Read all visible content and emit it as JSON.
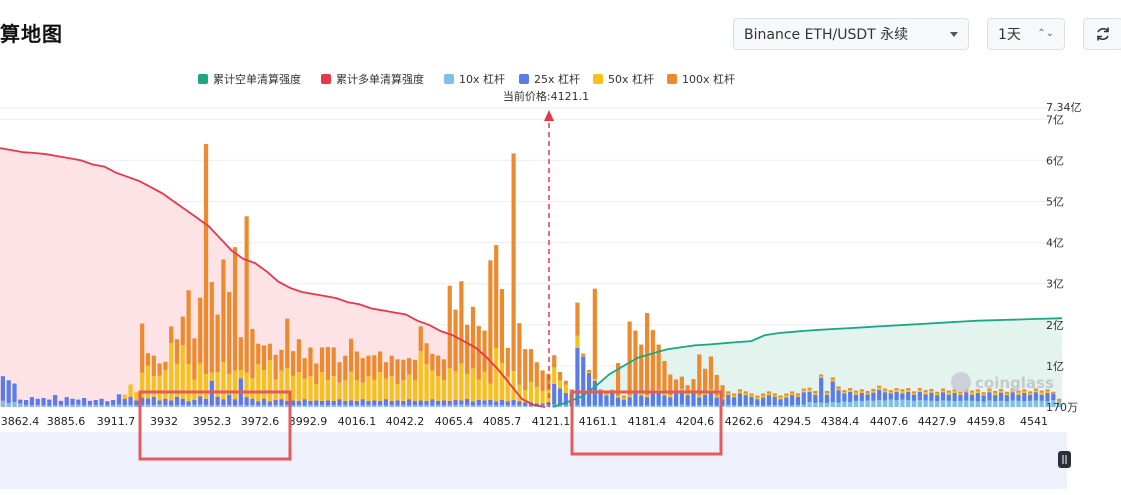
{
  "header": {
    "title": "算地图",
    "market": "Binance ETH/USDT 永续",
    "period": "1天",
    "period_arrows": "⌃⌄"
  },
  "colors": {
    "short_cum": "#1aa784",
    "long_cum": "#e8374b",
    "lev10": "#7fbfe8",
    "lev25": "#5b7be8",
    "lev50": "#f6c21a",
    "lev100": "#ee8a2e",
    "long_fill": "#fde3e5",
    "short_fill": "#e3f4ef",
    "price_line": "#e8374b",
    "highlight_box": "#e25c5c"
  },
  "chart_data": {
    "type": "bar",
    "legend": [
      {
        "key": "short_cum",
        "label": "累计空单清算强度",
        "kind": "line"
      },
      {
        "key": "long_cum",
        "label": "累计多单清算强度",
        "kind": "line"
      },
      {
        "key": "lev10",
        "label": "10x 杠杆",
        "kind": "bar"
      },
      {
        "key": "lev25",
        "label": "25x 杠杆",
        "kind": "bar"
      },
      {
        "key": "lev50",
        "label": "50x 杠杆",
        "kind": "bar"
      },
      {
        "key": "lev100",
        "label": "100x 杠杆",
        "kind": "bar"
      }
    ],
    "current_price_label": "当前价格:4121.1",
    "current_price": 4121.1,
    "x_ticks": [
      "3862.4",
      "3885.6",
      "3911.7",
      "3932",
      "3952.3",
      "3972.6",
      "3992.9",
      "4016.1",
      "4042.2",
      "4065.4",
      "4085.7",
      "4121.1",
      "4161.1",
      "4181.4",
      "4204.6",
      "4262.6",
      "4294.5",
      "4384.4",
      "4407.6",
      "4427.9",
      "4459.8",
      "4541"
    ],
    "y_ticks": [
      "170万",
      "1亿",
      "2亿",
      "3亿",
      "4亿",
      "5亿",
      "6亿",
      "7亿"
    ],
    "y_top_label": "7.34亿",
    "y_max_yi": 7.34,
    "highlighted_ranges": [
      [
        "3932",
        "3972.6"
      ],
      [
        "4161.1",
        "4204.6"
      ]
    ],
    "watermark": "coinglass",
    "series": {
      "lev10": [
        0.15,
        0.1,
        0.12,
        0.08,
        0.05,
        0.04,
        0.05,
        0.04,
        0.03,
        0.04,
        0.05,
        0.04,
        0.05,
        0.06,
        0.04,
        0.05,
        0.05,
        0.05,
        0.04,
        0.05,
        0.06,
        0.05,
        0.05,
        0.04,
        0.05,
        0.06,
        0.05,
        0.06,
        0.05,
        0.04,
        0.05,
        0.05,
        0.04,
        0.05,
        0.06,
        0.05,
        0.04,
        0.05,
        0.04,
        0.05,
        0.04,
        0.05,
        0.04,
        0.05,
        0.04,
        0.05,
        0.04,
        0.05,
        0.04,
        0.05,
        0.04,
        0.05,
        0.04,
        0.05,
        0.04,
        0.05,
        0.04,
        0.05,
        0.04,
        0.05,
        0.04,
        0.05,
        0.04,
        0.05,
        0.04,
        0.05,
        0.04,
        0.05,
        0.04,
        0.05,
        0.04,
        0.05,
        0.04,
        0.05,
        0.04,
        0.05,
        0.04,
        0.05,
        0.05,
        0.06,
        0.05,
        0.04,
        0.05,
        0.06,
        0.05,
        0.04,
        0.05,
        0.04,
        0.05,
        0.04,
        0.03,
        0.03,
        0.03,
        0.04,
        0.05,
        0.06,
        0.05,
        0.04,
        0.03,
        0.04,
        0.03,
        0.03,
        0.04,
        0.03,
        0.03,
        0.04,
        0.03,
        0.03,
        0.04,
        0.03,
        0.03,
        0.04,
        0.03,
        0.04,
        0.03,
        0.04,
        0.03,
        0.06,
        0.04,
        0.03,
        0.04,
        0.05,
        0.04,
        0.03,
        0.04,
        0.05,
        0.04,
        0.03,
        0.04,
        0.05,
        0.04,
        0.03,
        0.04,
        0.05,
        0.04,
        0.03,
        0.04,
        0.05,
        0.06,
        0.12,
        0.1,
        0.11,
        0.1,
        0.12,
        0.11,
        0.13,
        0.12,
        0.15,
        0.14,
        0.16,
        0.15,
        0.17,
        0.16,
        0.18,
        0.17,
        0.18,
        0.17,
        0.15,
        0.17,
        0.16,
        0.15,
        0.14,
        0.16,
        0.15,
        0.14,
        0.15,
        0.16,
        0.15,
        0.14,
        0.13,
        0.16,
        0.14,
        0.15,
        0.14,
        0.16,
        0.15,
        0.14,
        0.15,
        0.16,
        0.15,
        0.14,
        0.17,
        0.15
      ],
      "lev25": [
        0.6,
        0.55,
        0.45,
        0.1,
        0.12,
        0.2,
        0.15,
        0.18,
        0.15,
        0.25,
        0.1,
        0.2,
        0.15,
        0.12,
        0.18,
        0.1,
        0.12,
        0.15,
        0.1,
        0.12,
        0.25,
        0.15,
        0.2,
        0.12,
        0.18,
        0.15,
        0.2,
        0.1,
        0.15,
        0.12,
        0.2,
        0.15,
        0.1,
        0.12,
        0.2,
        0.15,
        0.6,
        0.2,
        0.15,
        0.25,
        0.15,
        0.65,
        0.2,
        0.15,
        0.1,
        0.15,
        0.1,
        0.12,
        0.15,
        0.1,
        0.12,
        0.1,
        0.15,
        0.1,
        0.12,
        0.1,
        0.12,
        0.1,
        0.15,
        0.1,
        0.12,
        0.1,
        0.15,
        0.1,
        0.12,
        0.1,
        0.15,
        0.1,
        0.12,
        0.1,
        0.15,
        0.1,
        0.12,
        0.1,
        0.15,
        0.1,
        0.12,
        0.1,
        0.12,
        0.1,
        0.15,
        0.1,
        0.12,
        0.1,
        0.12,
        0.1,
        0.12,
        0.1,
        0.12,
        0.1,
        0.08,
        0.08,
        0.06,
        0.05,
        0.06,
        0.5,
        0.4,
        0.3,
        0.3,
        1.4,
        1.2,
        0.8,
        0.6,
        0.3,
        0.25,
        0.3,
        0.2,
        0.15,
        0.2,
        0.3,
        0.25,
        0.2,
        0.3,
        0.35,
        0.25,
        0.2,
        0.3,
        0.35,
        0.25,
        0.3,
        0.2,
        0.25,
        0.35,
        0.2,
        0.15,
        0.25,
        0.2,
        0.3,
        0.25,
        0.2,
        0.15,
        0.2,
        0.25,
        0.2,
        0.15,
        0.2,
        0.25,
        0.2,
        0.3,
        0.25,
        0.2,
        0.6,
        0.2,
        0.5,
        0.3,
        0.2,
        0.25,
        0.15,
        0.2,
        0.15,
        0.2,
        0.25,
        0.2,
        0.15,
        0.2,
        0.15,
        0.2,
        0.15,
        0.2,
        0.15,
        0.2,
        0.15,
        0.2,
        0.15,
        0.2,
        0.15,
        0.2,
        0.15,
        0.2,
        0.15,
        0.2,
        0.15,
        0.2,
        0.15,
        0.2,
        0.15,
        0.2,
        0.15,
        0.2,
        0.15,
        0.2,
        0.15
      ],
      "lev50": [
        0,
        0,
        0,
        0,
        0,
        0,
        0,
        0,
        0,
        0,
        0,
        0,
        0,
        0,
        0,
        0,
        0,
        0,
        0,
        0,
        0,
        0.1,
        0.3,
        0.2,
        0.6,
        0.8,
        0.5,
        0.6,
        0.7,
        1.4,
        0.8,
        1.3,
        0.9,
        0.5,
        0.8,
        0.6,
        0.2,
        0.6,
        0.9,
        0.5,
        0.7,
        0.2,
        0.6,
        0.5,
        0.9,
        0.7,
        1.0,
        0.5,
        0.7,
        0.8,
        0.6,
        0.7,
        0.5,
        0.6,
        0.4,
        0.7,
        0.5,
        0.6,
        0.4,
        0.5,
        0.7,
        0.5,
        0.4,
        0.6,
        0.5,
        0.7,
        0.5,
        0.6,
        0.4,
        0.5,
        0.6,
        0.5,
        1.2,
        0.9,
        0.7,
        0.6,
        0.5,
        0.8,
        0.7,
        0.9,
        0.6,
        0.8,
        0.5,
        0.7,
        0.4,
        1.3,
        0.9,
        0.6,
        0.7,
        0.4,
        0.3,
        0.5,
        0.4,
        0.3,
        0.3,
        0.4,
        0.2,
        0.2,
        0.05,
        0.3,
        0.02,
        0.02,
        0.04,
        0.05,
        0.04,
        0.03,
        0.04,
        0.05,
        0.04,
        0.03,
        0.04,
        0.05,
        0.04,
        0.03,
        0.04,
        0.05,
        0.04,
        0.03,
        0.04,
        0.05,
        0.04,
        0.03,
        0.04,
        0.05,
        0.04,
        0.03,
        0.04,
        0.05,
        0.04,
        0.03,
        0.04,
        0.05,
        0.04,
        0.03,
        0.04,
        0.05,
        0.04,
        0.03,
        0.04,
        0.05,
        0.04,
        0.03,
        0.04,
        0.05,
        0.04,
        0.03,
        0.04,
        0.05,
        0.04,
        0.03,
        0.04,
        0.05,
        0.04,
        0.03,
        0.04,
        0.05,
        0.04,
        0.03,
        0.04,
        0.05,
        0.04,
        0.03,
        0.04,
        0.05,
        0.04,
        0.03,
        0.04,
        0.05,
        0.04,
        0.03,
        0.04,
        0.05,
        0.04,
        0.03,
        0.04,
        0.05,
        0.04,
        0.03,
        0.04,
        0.05,
        0.04
      ],
      "lev100": [
        0,
        0,
        0,
        0,
        0,
        0,
        0,
        0,
        0,
        0,
        0,
        0,
        0,
        0,
        0,
        0,
        0,
        0,
        0,
        0,
        0,
        0,
        0,
        0,
        1.2,
        0.3,
        0.5,
        0.3,
        0.2,
        0.4,
        0.6,
        0.7,
        1.8,
        1.0,
        1.6,
        5.6,
        2.2,
        1.4,
        2.5,
        2.0,
        3.0,
        0.8,
        3.8,
        1.2,
        0.5,
        0.6,
        0.4,
        0.6,
        0.5,
        1.2,
        0.6,
        0.8,
        0.5,
        0.7,
        0.5,
        0.6,
        0.8,
        0.7,
        0.5,
        0.6,
        0.8,
        0.7,
        0.6,
        0.5,
        0.6,
        0.5,
        0.4,
        0.5,
        0.6,
        0.5,
        0.4,
        0.5,
        0.6,
        0.5,
        0.4,
        0.5,
        0.5,
        2.0,
        1.5,
        2.0,
        1.2,
        1.5,
        1.3,
        1.0,
        3.0,
        2.5,
        1.8,
        0.7,
        5.3,
        1.5,
        1.0,
        0.8,
        0.6,
        0.5,
        0.4,
        0.3,
        0.2,
        0.1,
        0.05,
        0.8,
        0.05,
        0.05,
        2.2,
        0.05,
        0.05,
        0.05,
        0.8,
        0.05,
        1.8,
        1.5,
        1.2,
        2.0,
        1.5,
        1.1,
        0.8,
        0.5,
        0.3,
        0.3,
        0.2,
        0.3,
        1.0,
        0.6,
        0.8,
        0.5,
        0.3,
        0.05,
        0.05,
        0.05,
        0.05,
        0.05,
        0.05,
        0.05,
        0.05,
        0.05,
        0.05,
        0.05,
        0.05,
        0.05,
        0.05,
        0.05,
        0.05,
        0.05,
        0.05,
        0.05,
        0.05,
        0.05,
        0.05,
        0.05,
        0.05,
        0.05,
        0.05,
        0.05,
        0.05,
        0.05,
        0.05,
        0.05,
        0.05,
        0.05,
        0.05,
        0.05,
        0.05,
        0.05,
        0.05,
        0.05,
        0.05,
        0.05,
        0.05,
        0.05,
        0.05,
        0.05,
        0.05,
        0.05,
        0.05,
        0.05,
        0.05,
        0.05,
        0.05,
        0.05,
        0.05,
        0.05,
        0.05,
        0.05,
        0.05,
        0.05,
        0.05,
        0.05,
        0.05
      ],
      "long_cum": [
        6.3,
        6.25,
        6.2,
        6.18,
        6.15,
        6.1,
        6.05,
        6.0,
        5.9,
        5.85,
        5.7,
        5.6,
        5.5,
        5.35,
        5.2,
        5.0,
        4.8,
        4.6,
        4.4,
        4.1,
        3.8,
        3.6,
        3.5,
        3.3,
        3.05,
        2.9,
        2.8,
        2.75,
        2.7,
        2.65,
        2.55,
        2.5,
        2.4,
        2.35,
        2.3,
        2.25,
        2.1,
        2.0,
        1.85,
        1.75,
        1.6,
        1.45,
        1.2,
        0.9,
        0.55,
        0.2,
        0.05,
        0.0
      ],
      "short_cum": [
        0.0,
        0.12,
        0.25,
        0.5,
        0.8,
        1.0,
        1.2,
        1.3,
        1.4,
        1.45,
        1.5,
        1.52,
        1.55,
        1.58,
        1.6,
        1.75,
        1.8,
        1.83,
        1.86,
        1.88,
        1.9,
        1.92,
        1.94,
        1.96,
        1.98,
        2.0,
        2.02,
        2.04,
        2.06,
        2.08,
        2.1,
        2.11,
        2.12,
        2.13,
        2.14,
        2.15,
        2.16
      ]
    }
  }
}
